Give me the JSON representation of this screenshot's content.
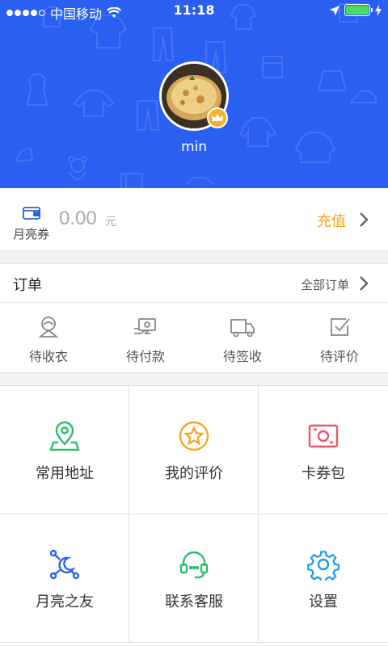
{
  "status_bar": {
    "carrier": "中国移动",
    "time": "11:18"
  },
  "profile": {
    "username": "min"
  },
  "coupon": {
    "label": "月亮券",
    "amount": "0.00",
    "unit": "元",
    "action": "充值"
  },
  "orders": {
    "title": "订单",
    "all_label": "全部订单",
    "tabs": [
      {
        "label": "待收衣",
        "icon": "laundry-pickup-icon"
      },
      {
        "label": "待付款",
        "icon": "payment-icon"
      },
      {
        "label": "待签收",
        "icon": "delivery-truck-icon"
      },
      {
        "label": "待评价",
        "icon": "review-check-icon"
      }
    ]
  },
  "grid": {
    "items": [
      {
        "label": "常用地址",
        "icon": "location-pin-icon",
        "color": "#2dbd6e"
      },
      {
        "label": "我的评价",
        "icon": "star-circle-icon",
        "color": "#f5a623"
      },
      {
        "label": "卡券包",
        "icon": "coupon-wallet-icon",
        "color": "#e8576c"
      },
      {
        "label": "月亮之友",
        "icon": "moon-network-icon",
        "color": "#2a60f2"
      },
      {
        "label": "联系客服",
        "icon": "headset-icon",
        "color": "#2dbd6e"
      },
      {
        "label": "设置",
        "icon": "gear-icon",
        "color": "#1e9bf0"
      }
    ]
  },
  "colors": {
    "header_bg": "#2a60f2",
    "accent_orange": "#f5a623"
  }
}
